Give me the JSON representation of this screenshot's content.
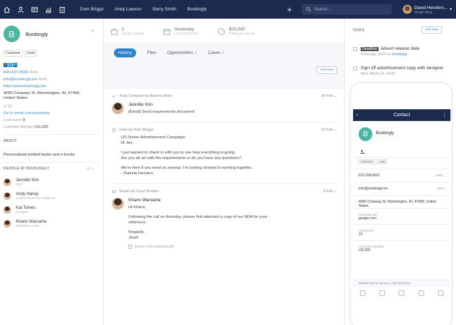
{
  "topbar": {
    "tabs": [
      "Dom Briggs",
      "Andy Lawson",
      "Barry Smith",
      "Bookingly"
    ],
    "search_placeholder": "Search...",
    "user_name": "David Henders...",
    "user_sub": "Design Shop"
  },
  "company": {
    "initial": "B",
    "name": "Bookingly",
    "tags": [
      "Customer",
      "Lead"
    ],
    "phone": "845-437-8600",
    "phone_type": "Work",
    "email": "info@bookingly.me",
    "email_type": "Work",
    "website": "http://www.bookingly.me",
    "address_line1": "4090 Conaway St, Bloomington, IN, 47408,",
    "address_line2": "United States",
    "time_count": "12",
    "email_conv": "Go to email conversations",
    "lead_score_label": "Lead score",
    "lead_score": "9",
    "customer_number_label": "Customer Number",
    "customer_number": "US-220"
  },
  "about": {
    "title": "ABOUT",
    "text": "Personalized printed books and e-books"
  },
  "people": {
    "title": "PEOPLE AT BOOKINGLY",
    "list": [
      {
        "name": "Jennifer Kim",
        "role": "CEO"
      },
      {
        "name": "Andy Haney",
        "role": "Head of Customer Relations"
      },
      {
        "name": "Kat Tomes",
        "role": "Designer"
      },
      {
        "name": "Khann Warsame",
        "role": "Production Lead"
      }
    ]
  },
  "stats": [
    {
      "value": "2",
      "label": "SALES CASES"
    },
    {
      "value": "Yesterday",
      "label": "LAST CONTACT"
    },
    {
      "value": "$22,000",
      "label": "PIPELINE VALUE"
    }
  ],
  "tabs": [
    {
      "label": "History",
      "count": ""
    },
    {
      "label": "Files",
      "count": ""
    },
    {
      "label": "Opportunities",
      "count": "2"
    },
    {
      "label": "Cases",
      "count": "2"
    }
  ],
  "add_note": "Add Note",
  "feed": [
    {
      "head": "Task Compled by Andrew Elliot",
      "date": "14 Feb",
      "name": "Jennifer Kim",
      "lines": [
        "[Email] Send requirements document"
      ]
    },
    {
      "head": "Note by Dom Briggs",
      "date": "10 Feb",
      "lines": [
        "US Online Advertisement Campaign",
        "Hi Jen,",
        "",
        "I just wanted to check in with you to see how everything is going.",
        "Are you all set with the requirements or do you have any questions?",
        "",
        "We're here if you need us anyway. I'm looking forward to working together.",
        "- Daniela Henders"
      ]
    },
    {
      "head": "Email via Josef Snotten",
      "date": "6 Feb",
      "name": "Khann Warsame",
      "lines": [
        "Hi Khann,",
        "",
        "Following the call on thursday, please find attached a copy of our NDA for your",
        "reference.",
        "",
        "Regards,",
        "Josef"
      ],
      "attachment": "project-nda-standard.pdf"
    }
  ],
  "tasks": {
    "title": "TASKS",
    "add_label": "Add Task",
    "items": [
      {
        "badge": "Deadline",
        "title": "Advert release date",
        "meta_time": "Yesterday, 18:20",
        "meta_for": "for",
        "meta_link": "Bookingly"
      },
      {
        "badge": "",
        "title": "Sign off advertisement copy with designer",
        "meta_time": "Wed, March 14, 14:00",
        "meta_for": "",
        "meta_link": ""
      }
    ]
  },
  "phone": {
    "header": "Contact",
    "name": "Bookingly",
    "tags": [
      "Customer",
      "Lead"
    ],
    "phone": "812-338-8007",
    "phone_type": "Work",
    "email": "info@bookingly.me",
    "email_type": "Work",
    "address": "4090 Conaway St, Bloomington, IN, 47408, United States",
    "referring_label": "Referring site",
    "referring": "google.com",
    "lead_label": "Lead score",
    "lead": "10",
    "cust_label": "Customer Number",
    "cust": "US-220",
    "section": "WEBSITES & SOCIAL NETWORKS"
  }
}
